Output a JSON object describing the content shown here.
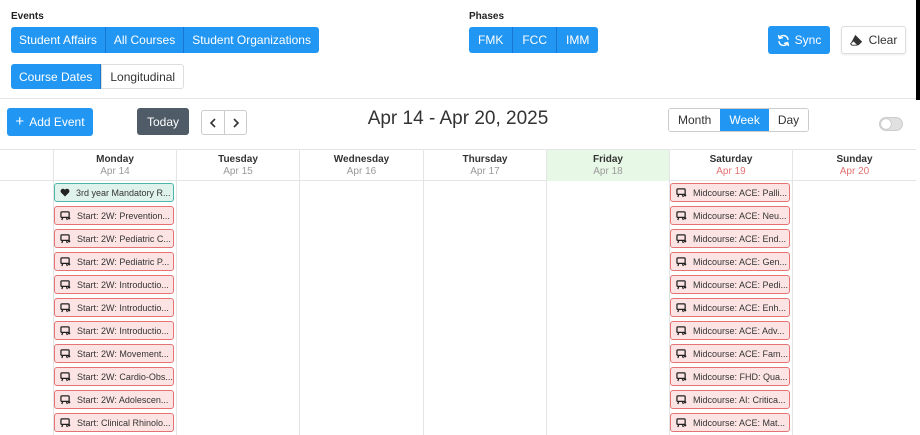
{
  "events_section": {
    "label": "Events",
    "buttons": [
      "Student Affairs",
      "All Courses",
      "Student Organizations"
    ]
  },
  "phases_section": {
    "label": "Phases",
    "buttons": [
      "FMK",
      "FCC",
      "IMM"
    ]
  },
  "sync_label": "Sync",
  "clear_label": "Clear",
  "date_mode": {
    "options": [
      "Course Dates",
      "Longitudinal"
    ],
    "active": "Course Dates"
  },
  "add_event_label": "Add Event",
  "today_label": "Today",
  "range_title": "Apr 14 - Apr 20, 2025",
  "views": {
    "options": [
      "Month",
      "Week",
      "Day"
    ],
    "active": "Week"
  },
  "days": [
    {
      "name": "Monday",
      "date": "Apr 14"
    },
    {
      "name": "Tuesday",
      "date": "Apr 15"
    },
    {
      "name": "Wednesday",
      "date": "Apr 16"
    },
    {
      "name": "Thursday",
      "date": "Apr 17"
    },
    {
      "name": "Friday",
      "date": "Apr 18"
    },
    {
      "name": "Saturday",
      "date": "Apr 19"
    },
    {
      "name": "Sunday",
      "date": "Apr 20"
    }
  ],
  "colors": {
    "accent": "#2196f3",
    "today_bg": "#e8f8e6",
    "event_red_bg": "#fde4e4",
    "event_red_border": "#e57373",
    "event_green_bg": "#dff3ec"
  },
  "monday_events": [
    {
      "title": "3rd year Mandatory R...",
      "icon": "heart-icon",
      "style": "green"
    },
    {
      "title": "Start: 2W: Prevention...",
      "icon": "lectern-icon",
      "style": "red"
    },
    {
      "title": "Start: 2W: Pediatric C...",
      "icon": "lectern-icon",
      "style": "red"
    },
    {
      "title": "Start: 2W: Pediatric P...",
      "icon": "lectern-icon",
      "style": "red"
    },
    {
      "title": "Start: 2W: Introductio...",
      "icon": "lectern-icon",
      "style": "red"
    },
    {
      "title": "Start: 2W: Introductio...",
      "icon": "lectern-icon",
      "style": "red"
    },
    {
      "title": "Start: 2W: Introductio...",
      "icon": "lectern-icon",
      "style": "red"
    },
    {
      "title": "Start: 2W: Movement...",
      "icon": "lectern-icon",
      "style": "red"
    },
    {
      "title": "Start: 2W: Cardio-Obs...",
      "icon": "lectern-icon",
      "style": "red"
    },
    {
      "title": "Start: 2W: Adolescen...",
      "icon": "lectern-icon",
      "style": "red"
    },
    {
      "title": "Start: Clinical Rhinolo...",
      "icon": "lectern-icon",
      "style": "red"
    }
  ],
  "saturday_events": [
    {
      "title": "Midcourse: ACE: Palli...",
      "icon": "lectern-icon",
      "style": "red"
    },
    {
      "title": "Midcourse: ACE: Neu...",
      "icon": "lectern-icon",
      "style": "red"
    },
    {
      "title": "Midcourse: ACE: End...",
      "icon": "lectern-icon",
      "style": "red"
    },
    {
      "title": "Midcourse: ACE: Gen...",
      "icon": "lectern-icon",
      "style": "red"
    },
    {
      "title": "Midcourse: ACE: Pedi...",
      "icon": "lectern-icon",
      "style": "red"
    },
    {
      "title": "Midcourse: ACE: Enh...",
      "icon": "lectern-icon",
      "style": "red"
    },
    {
      "title": "Midcourse: ACE: Adv...",
      "icon": "lectern-icon",
      "style": "red"
    },
    {
      "title": "Midcourse: ACE: Fam...",
      "icon": "lectern-icon",
      "style": "red"
    },
    {
      "title": "Midcourse: FHD: Qua...",
      "icon": "lectern-icon",
      "style": "red"
    },
    {
      "title": "Midcourse: AI: Critica...",
      "icon": "lectern-icon",
      "style": "red"
    },
    {
      "title": "Midcourse: ACE: Mat...",
      "icon": "lectern-icon",
      "style": "red"
    }
  ]
}
